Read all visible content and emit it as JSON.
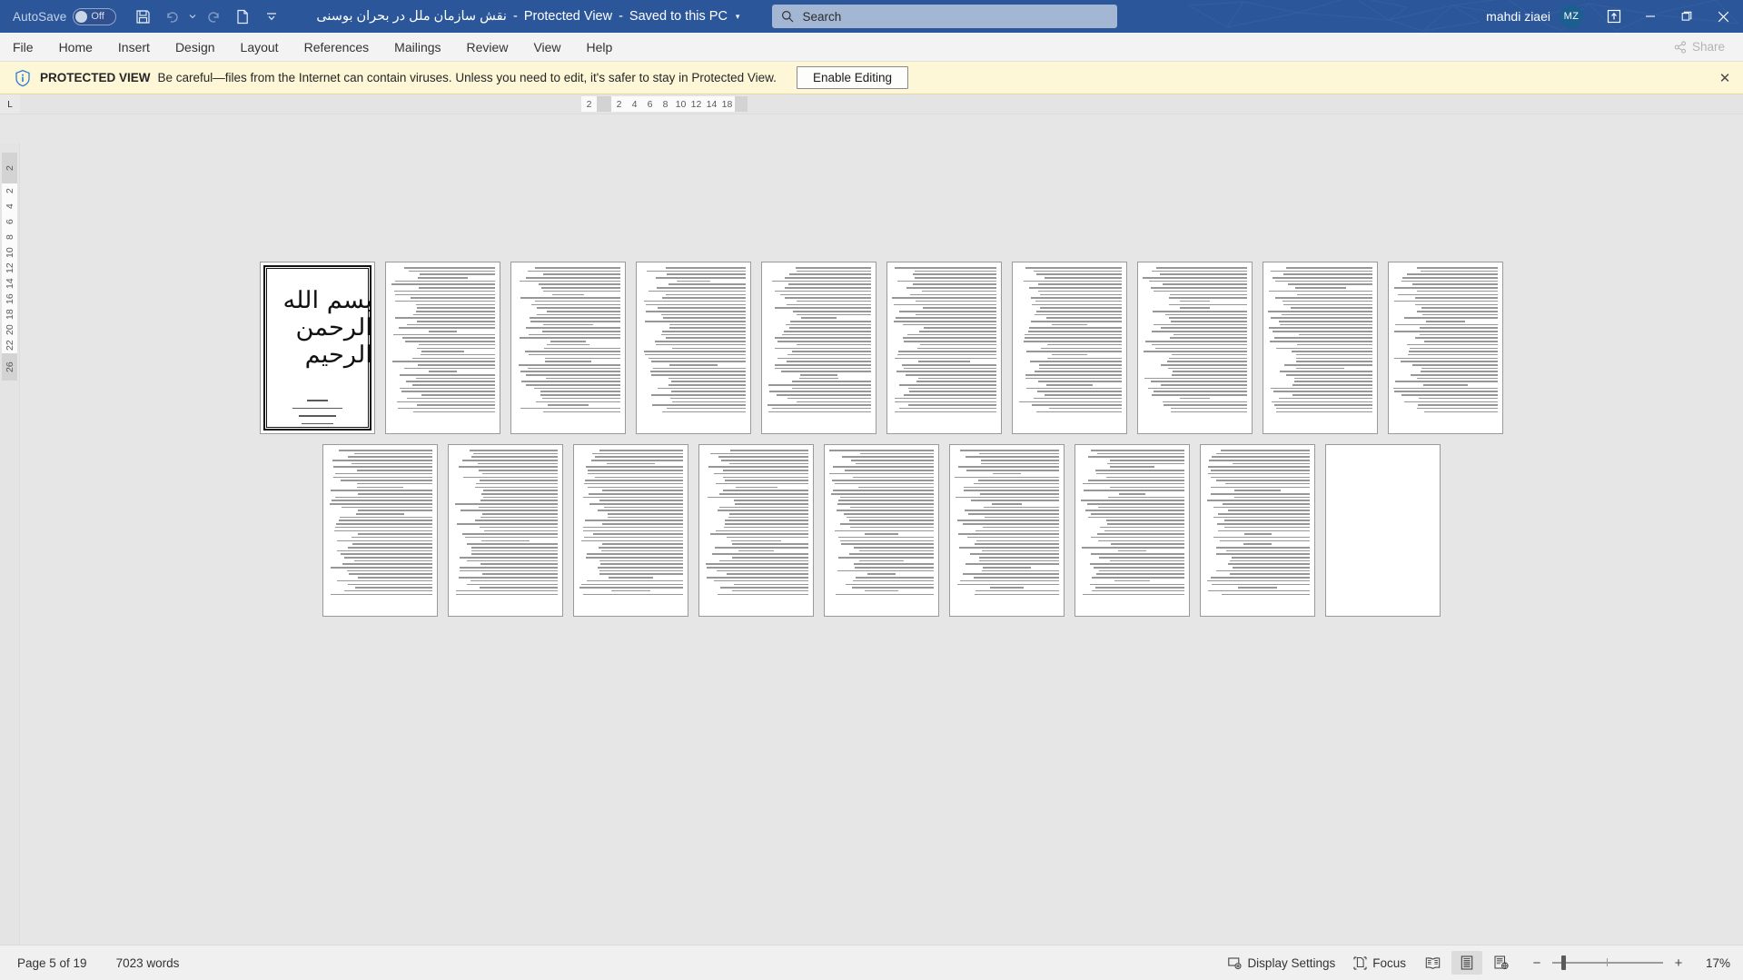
{
  "titlebar": {
    "autosave_label": "AutoSave",
    "autosave_state": "Off",
    "quick_access": [
      {
        "name": "save-button",
        "icon": "save-icon"
      },
      {
        "name": "undo-button",
        "icon": "undo-icon"
      },
      {
        "name": "redo-button",
        "icon": "redo-icon"
      },
      {
        "name": "new-document-button",
        "icon": "document-icon"
      },
      {
        "name": "customize-quick-access-button",
        "icon": "chevron-down-icon"
      }
    ],
    "document_name": "نقش سازمان ملل در بحران بوسنی",
    "protected_view_label": "Protected View",
    "saved_location": "Saved to this PC",
    "title_separator": "-",
    "search_placeholder": "Search",
    "user_name": "mahdi ziaei",
    "user_initials": "MZ",
    "window_buttons": {
      "ribbon_display": "ribbon-display-options-icon",
      "minimize": "–",
      "restore": "❐",
      "close": "✕"
    }
  },
  "ribbon": {
    "tabs": [
      {
        "label": "File",
        "active": false
      },
      {
        "label": "Home",
        "active": false
      },
      {
        "label": "Insert",
        "active": false
      },
      {
        "label": "Design",
        "active": false
      },
      {
        "label": "Layout",
        "active": false
      },
      {
        "label": "References",
        "active": false
      },
      {
        "label": "Mailings",
        "active": false
      },
      {
        "label": "Review",
        "active": false
      },
      {
        "label": "View",
        "active": false
      },
      {
        "label": "Help",
        "active": false
      }
    ],
    "share_label": "Share"
  },
  "protected_view": {
    "title": "PROTECTED VIEW",
    "message": "Be careful—files from the Internet can contain viruses. Unless you need to edit, it's safer to stay in Protected View.",
    "button_label": "Enable Editing",
    "close_label": "✕",
    "bar_color": "#fdf7d7"
  },
  "rulers": {
    "horizontal_numbers": [
      "18",
      "14",
      "12",
      "10",
      "8",
      "6",
      "4",
      "2",
      "2"
    ],
    "vertical_numbers": [
      "2",
      "2",
      "4",
      "6",
      "8",
      "10",
      "12",
      "14",
      "16",
      "18",
      "20",
      "22",
      "26"
    ],
    "tab_selector": "L"
  },
  "document": {
    "zoom_percent": 17,
    "cover_page": {
      "calligraphy": "بسم الله الرحمن الرحیم",
      "subtitle": "عنوان :",
      "line_count": 5
    },
    "row1_pages": 10,
    "row2_pages": 9,
    "last_page_blank": true
  },
  "statusbar": {
    "page_indicator": "Page 5 of 19",
    "word_count": "7023 words",
    "display_settings_label": "Display Settings",
    "focus_label": "Focus",
    "view_buttons": [
      {
        "name": "read-mode-button",
        "icon": "read-mode-icon",
        "active": false
      },
      {
        "name": "print-layout-button",
        "icon": "print-layout-icon",
        "active": true
      },
      {
        "name": "web-layout-button",
        "icon": "web-layout-icon",
        "active": false
      }
    ],
    "zoom_out_label": "−",
    "zoom_in_label": "+",
    "zoom_label": "17%"
  },
  "colors": {
    "accent": "#2b579a",
    "titlebar": "#2b579a",
    "ribbon_bg": "#f3f3f3",
    "warning_bg": "#fdf7d7",
    "page_bg": "#e6e6e6",
    "avatar": "#1b5e8f"
  }
}
